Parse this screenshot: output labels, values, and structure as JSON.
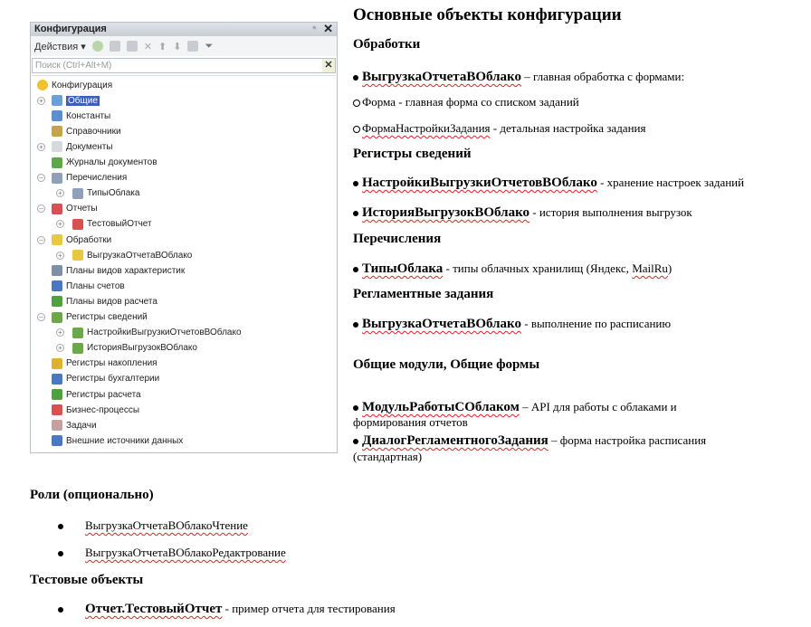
{
  "panel": {
    "title": "Конфигурация",
    "actions_label": "Действия",
    "search_placeholder": "Поиск (Ctrl+Alt+M)",
    "tree": [
      {
        "label": "Конфигурация",
        "level": 0,
        "icon": "config-icon",
        "exp": "",
        "color": "#f2c12e"
      },
      {
        "label": "Общие",
        "level": 1,
        "icon": "common-icon",
        "exp": "+",
        "color": "#6a9fd8",
        "selected": true
      },
      {
        "label": "Константы",
        "level": 1,
        "icon": "constants-icon",
        "exp": "",
        "color": "#5b8fd0"
      },
      {
        "label": "Справочники",
        "level": 1,
        "icon": "catalogs-icon",
        "exp": "",
        "color": "#c7a34a"
      },
      {
        "label": "Документы",
        "level": 1,
        "icon": "documents-icon",
        "exp": "+",
        "color": "#d6d9de"
      },
      {
        "label": "Журналы документов",
        "level": 1,
        "icon": "journals-icon",
        "exp": "",
        "color": "#5aa84a"
      },
      {
        "label": "Перечисления",
        "level": 1,
        "icon": "enums-icon",
        "exp": "-",
        "color": "#8fa0b8"
      },
      {
        "label": "ТипыОблака",
        "level": 2,
        "icon": "enum-icon",
        "exp": "+",
        "color": "#8fa0b8"
      },
      {
        "label": "Отчеты",
        "level": 1,
        "icon": "reports-icon",
        "exp": "-",
        "color": "#d85050"
      },
      {
        "label": "ТестовыйОтчет",
        "level": 2,
        "icon": "report-icon",
        "exp": "+",
        "color": "#d85050"
      },
      {
        "label": "Обработки",
        "level": 1,
        "icon": "dataprocessors-icon",
        "exp": "-",
        "color": "#e8c840"
      },
      {
        "label": "ВыгрузкаОтчетаВОблако",
        "level": 2,
        "icon": "dataprocessor-icon",
        "exp": "+",
        "color": "#e8c840"
      },
      {
        "label": "Планы видов характеристик",
        "level": 1,
        "icon": "chart-of-characteristics-icon",
        "exp": "",
        "color": "#7f8fa8"
      },
      {
        "label": "Планы счетов",
        "level": 1,
        "icon": "chart-of-accounts-icon",
        "exp": "",
        "color": "#4a78c0"
      },
      {
        "label": "Планы видов расчета",
        "level": 1,
        "icon": "chart-of-calculation-icon",
        "exp": "",
        "color": "#4ea040"
      },
      {
        "label": "Регистры сведений",
        "level": 1,
        "icon": "info-registers-icon",
        "exp": "-",
        "color": "#6aa84a"
      },
      {
        "label": "НастройкиВыгрузкиОтчетовВОблако",
        "level": 2,
        "icon": "info-register-icon",
        "exp": "+",
        "color": "#6aa84a"
      },
      {
        "label": "ИсторияВыгрузокВОблако",
        "level": 2,
        "icon": "info-register-icon",
        "exp": "+",
        "color": "#6aa84a"
      },
      {
        "label": "Регистры накопления",
        "level": 1,
        "icon": "accumulation-registers-icon",
        "exp": "",
        "color": "#e0b030"
      },
      {
        "label": "Регистры бухгалтерии",
        "level": 1,
        "icon": "accounting-registers-icon",
        "exp": "",
        "color": "#4a78c0"
      },
      {
        "label": "Регистры расчета",
        "level": 1,
        "icon": "calculation-registers-icon",
        "exp": "",
        "color": "#4ea040"
      },
      {
        "label": "Бизнес-процессы",
        "level": 1,
        "icon": "business-processes-icon",
        "exp": "",
        "color": "#d85050"
      },
      {
        "label": "Задачи",
        "level": 1,
        "icon": "tasks-icon",
        "exp": "",
        "color": "#c9a0a0"
      },
      {
        "label": "Внешние источники данных",
        "level": 1,
        "icon": "external-data-sources-icon",
        "exp": "",
        "color": "#4a78c0"
      }
    ]
  },
  "doc": {
    "title": "Основные объекты конфигурации",
    "s1": "Обработки",
    "s1_i1_name": "ВыгрузкаОтчетаВОблако",
    "s1_i1_desc": " – главная обработка с формами:",
    "s1_f1": "Форма - главная форма со списком заданий",
    "s1_f2_name": "ФормаНастройкиЗадания",
    "s1_f2_desc": " - детальная настройка задания",
    "s2": "Регистры сведений",
    "s2_i1_name": "НастройкиВыгрузкиОтчетовВОблако",
    "s2_i1_desc": " - хранение настроек заданий",
    "s2_i2_name": "ИсторияВыгрузокВОблако",
    "s2_i2_desc": " - история выполнения выгрузок",
    "s3": "Перечисления",
    "s3_i1_name": "ТипыОблака",
    "s3_i1_desc": " - типы облачных хранилищ (Яндекс, ",
    "s3_i1_mail": "MailRu",
    "s3_i1_end": ")",
    "s4": "Регламентные задания",
    "s4_i1_name": "ВыгрузкаОтчетаВОблако",
    "s4_i1_desc": " - выполнение по расписанию",
    "s5": "Общие модули, Общие формы",
    "s5_i1_name": "МодульРаботыСОблаком",
    "s5_i1_desc": " – API для работы с облаками и",
    "s5_i1_cont": "формирования отчетов",
    "s5_i2_name": "ДиалогРегламентногоЗадания",
    "s5_i2_desc": " – форма настройка расписания",
    "s5_i2_cont": "(стандартная)",
    "s6": "Роли (опционально)",
    "s6_i1": "ВыгрузкаОтчетаВОблакоЧтение",
    "s6_i2": "ВыгрузкаОтчетаВОблакоРедактрование",
    "s7": "Тестовые объекты",
    "s7_i1_name": "Отчет.ТестовыйОтчет",
    "s7_i1_desc": " - пример отчета для тестирования"
  }
}
